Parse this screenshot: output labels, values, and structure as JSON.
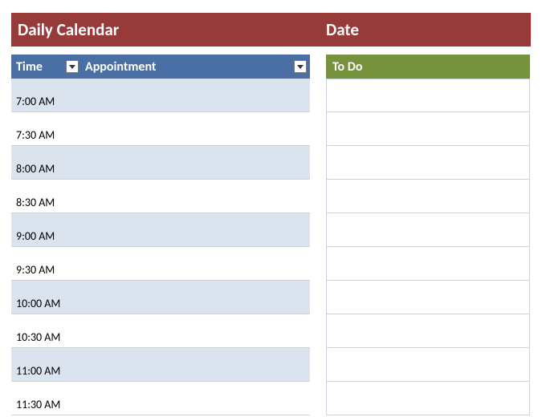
{
  "header": {
    "title_left": "Daily Calendar",
    "title_right": "Date"
  },
  "columns": {
    "time": "Time",
    "appointment": "Appointment",
    "todo": "To Do"
  },
  "schedule": [
    {
      "time": "7:00 AM",
      "appointment": ""
    },
    {
      "time": "7:30 AM",
      "appointment": ""
    },
    {
      "time": "8:00 AM",
      "appointment": ""
    },
    {
      "time": "8:30 AM",
      "appointment": ""
    },
    {
      "time": "9:00 AM",
      "appointment": ""
    },
    {
      "time": "9:30 AM",
      "appointment": ""
    },
    {
      "time": "10:00 AM",
      "appointment": ""
    },
    {
      "time": "10:30 AM",
      "appointment": ""
    },
    {
      "time": "11:00 AM",
      "appointment": ""
    },
    {
      "time": "11:30 AM",
      "appointment": ""
    }
  ],
  "todo_rows": 10,
  "colors": {
    "header_bg": "#963a3a",
    "time_head_bg": "#4a6fa5",
    "todo_head_bg": "#76923c",
    "row_alt_bg": "#dbe3ef",
    "border": "#c9d4e3"
  }
}
